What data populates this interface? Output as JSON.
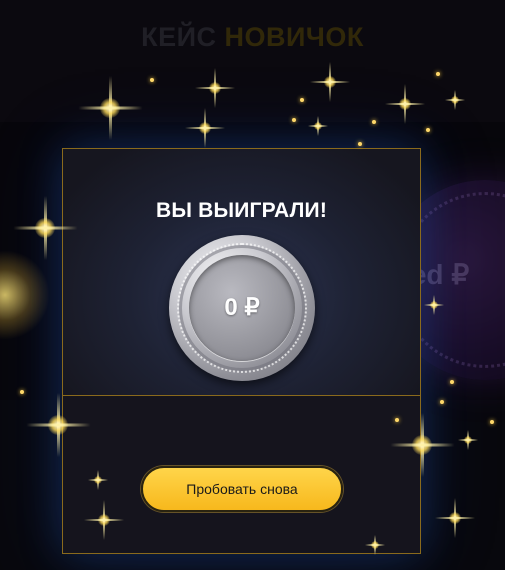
{
  "background": {
    "title_part1": "КЕЙС",
    "title_part2": "НОВИЧОК",
    "coin_text": "ed ₽"
  },
  "modal": {
    "title": "ВЫ ВЫИГРАЛИ!",
    "prize_value": "0 ₽",
    "retry_button": "Пробовать снова"
  },
  "colors": {
    "accent_gold": "#f7b81c",
    "border_gold": "#8a6a1c",
    "coin_silver": "#c9c9cf"
  }
}
